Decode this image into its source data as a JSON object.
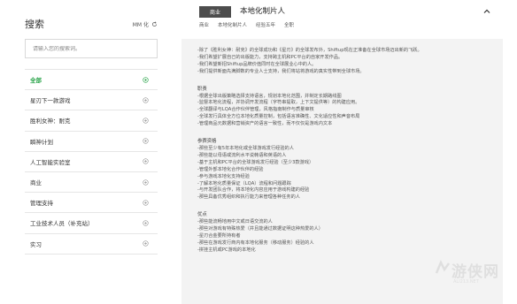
{
  "sidebar": {
    "title": "搜索",
    "reset_label": "MM 化",
    "search": {
      "placeholder": "请输入您的搜索词。",
      "value": ""
    },
    "categories": [
      {
        "label": "全部",
        "active": true
      },
      {
        "label": "星刃下一款游戏",
        "active": false
      },
      {
        "label": "胜利女神：耐克",
        "active": false
      },
      {
        "label": "瞬神计划",
        "active": false
      },
      {
        "label": "人工智能实验室",
        "active": false
      },
      {
        "label": "商业",
        "active": false
      },
      {
        "label": "管理支持",
        "active": false
      },
      {
        "label": "工业技术人员（补充站）",
        "active": false
      },
      {
        "label": "实习",
        "active": false
      }
    ]
  },
  "job": {
    "tag": "商业",
    "title": "本地化制片人",
    "meta": [
      "商业",
      "本地化制片人",
      "经验五年",
      "全职"
    ],
    "intro": [
      "-除了《胜利女神：耐克》的全球成功和《星刃》的全球发布外，Shiftup现在正准备在全球市场迈出新的飞跃。",
      "-我们希望扩展自己的出版能力，支持跨主机和PC平台的自家开发作品。",
      "-我们希望新招Shiftup品牌价值同时在全球展业心中的人。",
      "-我们提供新面先满脚数的专业人士支持，我们将站将游戏的真实性带到全球市场。"
    ],
    "sections": [
      {
        "title": "职责",
        "lines": [
          "-根据全球出版策略选择支持语言，规划本地化范围，并制定长期路线图",
          "-监督本地化流程，并协调开发流程（字符串提取，上下文提供等）的构建应用。",
          "-全球翻译与LQA合作伙伴管理，风格指南制作与质量审核",
          "-全球发行具体全方位本地化质量控制，包括语言准确性、文化适应性和声音布局",
          "-管理商品元数据和营销资产的语言一致性，而不仅仅是游戏内文本"
        ]
      },
      {
        "title": "参赛资格",
        "lines": [
          "-那些至少有5年本地化或全球游戏发行经验的人",
          "-那些能以母语或流利水平说韩语和英语的人",
          "-基于主机和PC平台的全球游戏发行经验（至少3款游戏）",
          "-管理外部本地化合作伙伴的经验",
          "-参与游戏本地化支持经验",
          "-了解本地化质量保证（LQA）流程和问题跟踪",
          "-与开发团队合作，将本地化内容应用于游戏构建的经验",
          "-那些具备优秀组织和执行能力来管理各种任务的人"
        ]
      },
      {
        "title": "优点",
        "lines": [
          "-那些能流畅地用中文或日语交流的人",
          "-那些对游戏有特殊热爱（并且能通过数据证明这种热爱的人）",
          "-星刃合金要所持有者",
          "-那些在游戏发行商内有本地化服务（移动服务）经验的人",
          "-拼挂主机或PC游戏的本地化"
        ]
      }
    ]
  },
  "watermark": {
    "text": "游侠网",
    "sub": "ALI213.NET"
  }
}
